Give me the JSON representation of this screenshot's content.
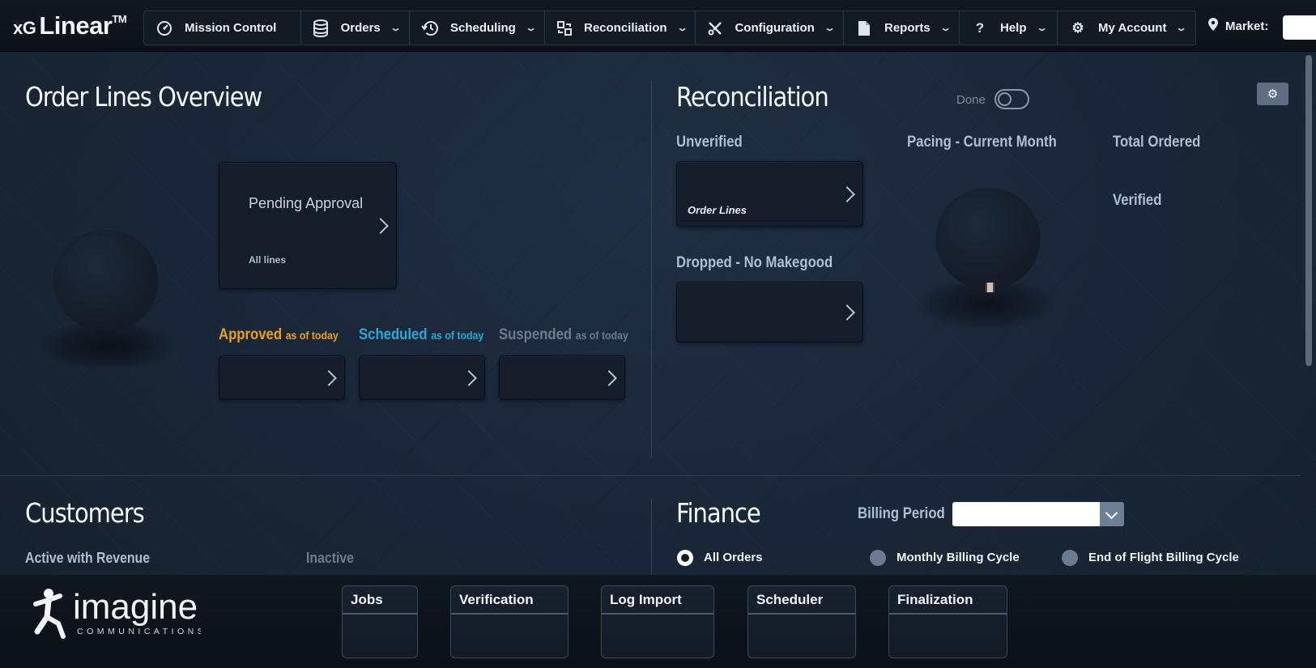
{
  "brand": {
    "prefix": "xG",
    "name": "Linear",
    "tm": "TM"
  },
  "nav": [
    {
      "label": "Mission Control",
      "icon": "dashboard-icon",
      "dropdown": false
    },
    {
      "label": "Orders",
      "icon": "database-icon",
      "dropdown": true
    },
    {
      "label": "Scheduling",
      "icon": "history-icon",
      "dropdown": true
    },
    {
      "label": "Reconciliation",
      "icon": "reconcile-icon",
      "dropdown": true
    },
    {
      "label": "Configuration",
      "icon": "tools-icon",
      "dropdown": true
    },
    {
      "label": "Reports",
      "icon": "document-icon",
      "dropdown": true
    },
    {
      "label": "Help",
      "icon": "question-icon",
      "dropdown": true
    },
    {
      "label": "My Account",
      "icon": "gear-icon",
      "dropdown": true
    }
  ],
  "market": {
    "label": "Market:",
    "value": ""
  },
  "order_lines": {
    "title": "Order Lines Overview",
    "pending": {
      "title": "Pending Approval",
      "sub": "All lines"
    },
    "approved": {
      "label": "Approved",
      "suffix": "as of today",
      "color": "#e8a21a"
    },
    "scheduled": {
      "label": "Scheduled",
      "suffix": "as of today",
      "color": "#2aa7d6"
    },
    "suspended": {
      "label": "Suspended",
      "suffix": "as of today",
      "color": "#6f7b8a"
    }
  },
  "reconciliation": {
    "title": "Reconciliation",
    "done_label": "Done",
    "done_checked": false,
    "unverified": {
      "label": "Unverified",
      "card_label": "Order Lines"
    },
    "dropped": {
      "label": "Dropped - No Makegood"
    },
    "pacing": {
      "label": "Pacing - Current Month"
    },
    "total_ordered": {
      "label": "Total Ordered"
    },
    "verified": {
      "label": "Verified"
    }
  },
  "customers": {
    "title": "Customers",
    "active_label": "Active with Revenue",
    "inactive_label": "Inactive"
  },
  "finance": {
    "title": "Finance",
    "billing_period_label": "Billing Period",
    "billing_period_value": "",
    "options": [
      {
        "label": "All Orders",
        "selected": true
      },
      {
        "label": "Monthly Billing Cycle",
        "selected": false
      },
      {
        "label": "End of Flight Billing Cycle",
        "selected": false
      }
    ]
  },
  "footer": {
    "logo": {
      "name": "imagine",
      "sub": "COMMUNICATIONS"
    },
    "tiles": [
      "Jobs",
      "Verification",
      "Log Import",
      "Scheduler",
      "Finalization"
    ]
  }
}
